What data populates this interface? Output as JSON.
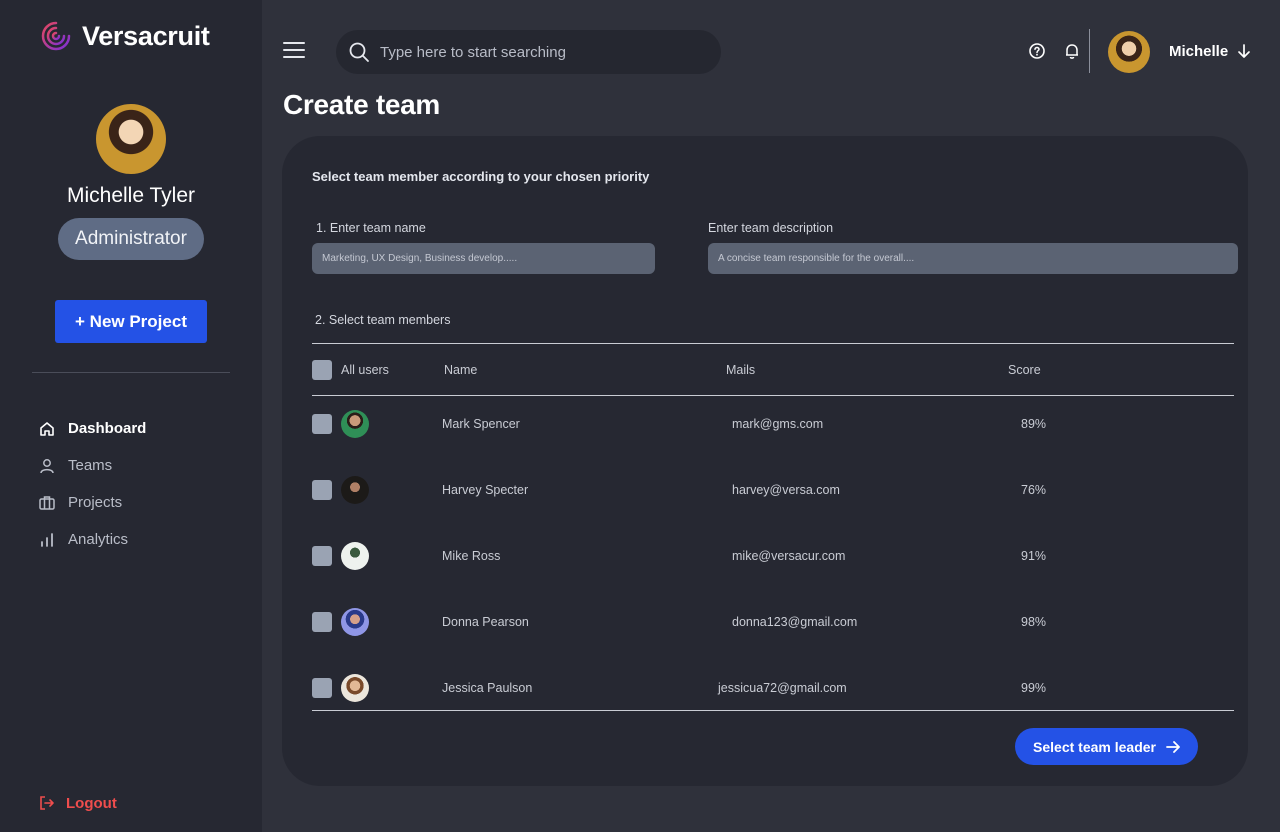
{
  "brand": {
    "name": "Versacruit"
  },
  "profile": {
    "name": "Michelle Tyler",
    "role": "Administrator"
  },
  "sidebar": {
    "new_project_label": "+ New Project",
    "items": [
      {
        "label": "Dashboard",
        "icon": "home-icon",
        "active": true
      },
      {
        "label": "Teams",
        "icon": "user-icon",
        "active": false
      },
      {
        "label": "Projects",
        "icon": "briefcase-icon",
        "active": false
      },
      {
        "label": "Analytics",
        "icon": "bar-chart-icon",
        "active": false
      }
    ],
    "logout_label": "Logout"
  },
  "topbar": {
    "search_placeholder": "Type here to start searching",
    "user_name": "Michelle"
  },
  "page": {
    "title": "Create team"
  },
  "form": {
    "heading": "Select team member according to your chosen priority",
    "team_name_label": "1. Enter team name",
    "team_name_placeholder": "Marketing, UX Design, Business develop.....",
    "team_desc_label": "Enter team description",
    "team_desc_placeholder": "A concise team responsible for the overall....",
    "members_label": "2. Select team members"
  },
  "table": {
    "headers": {
      "all": "All users",
      "name": "Name",
      "mail": "Mails",
      "score": "Score"
    },
    "rows": [
      {
        "name": "Mark Spencer",
        "mail": "mark@gms.com",
        "score": "89%"
      },
      {
        "name": "Harvey Specter",
        "mail": "harvey@versa.com",
        "score": "76%"
      },
      {
        "name": "Mike Ross",
        "mail": "mike@versacur.com",
        "score": "91%"
      },
      {
        "name": "Donna Pearson",
        "mail": "donna123@gmail.com",
        "score": "98%"
      },
      {
        "name": "Jessica Paulson",
        "mail": "jessicua72@gmail.com",
        "score": "99%"
      }
    ]
  },
  "actions": {
    "select_leader_label": "Select team leader"
  },
  "colors": {
    "accent": "#2452e6",
    "logout": "#ef4d4d",
    "background": "#2f313b",
    "sidebar": "#262832"
  }
}
